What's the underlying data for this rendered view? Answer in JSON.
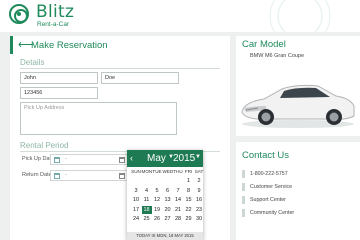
{
  "header": {
    "brand": "Blitz",
    "tagline": "Rent-a-Car"
  },
  "reservation": {
    "title": "Make Reservation",
    "details_heading": "Details",
    "first_name": "John",
    "last_name": "Doe",
    "id_number": "123456",
    "pickup_address_placeholder": "Pick Up Address",
    "rental_heading": "Rental Period",
    "pickup_date_label": "Pick Up Date",
    "return_date_label": "Return Date",
    "date_placeholder": "-"
  },
  "calendar": {
    "month": "May",
    "year": "2015",
    "weekdays": [
      "SUN",
      "MON",
      "TUE",
      "WED",
      "THU",
      "FRI",
      "SAT"
    ],
    "days": [
      "1",
      "2",
      "3",
      "4",
      "5",
      "6",
      "7",
      "8",
      "9",
      "10",
      "11",
      "12",
      "13",
      "14",
      "15",
      "16",
      "17",
      "18",
      "19",
      "20",
      "21",
      "22",
      "23",
      "24",
      "25",
      "26",
      "27",
      "28",
      "29",
      "30"
    ],
    "selected_day": "18",
    "footer": "TODAY IS MON, 18 MAY 2015",
    "accent": "#1e7a52"
  },
  "car": {
    "heading": "Car Model",
    "model": "BMW M6 Gran Coupe"
  },
  "contact": {
    "heading": "Contact Us",
    "phone": "1-800-222-5757",
    "customer_service": "Customer Service",
    "support_center": "Support Center",
    "community_center": "Community Center"
  },
  "colors": {
    "brand": "#1e8a5b",
    "background": "#eef0f0"
  }
}
